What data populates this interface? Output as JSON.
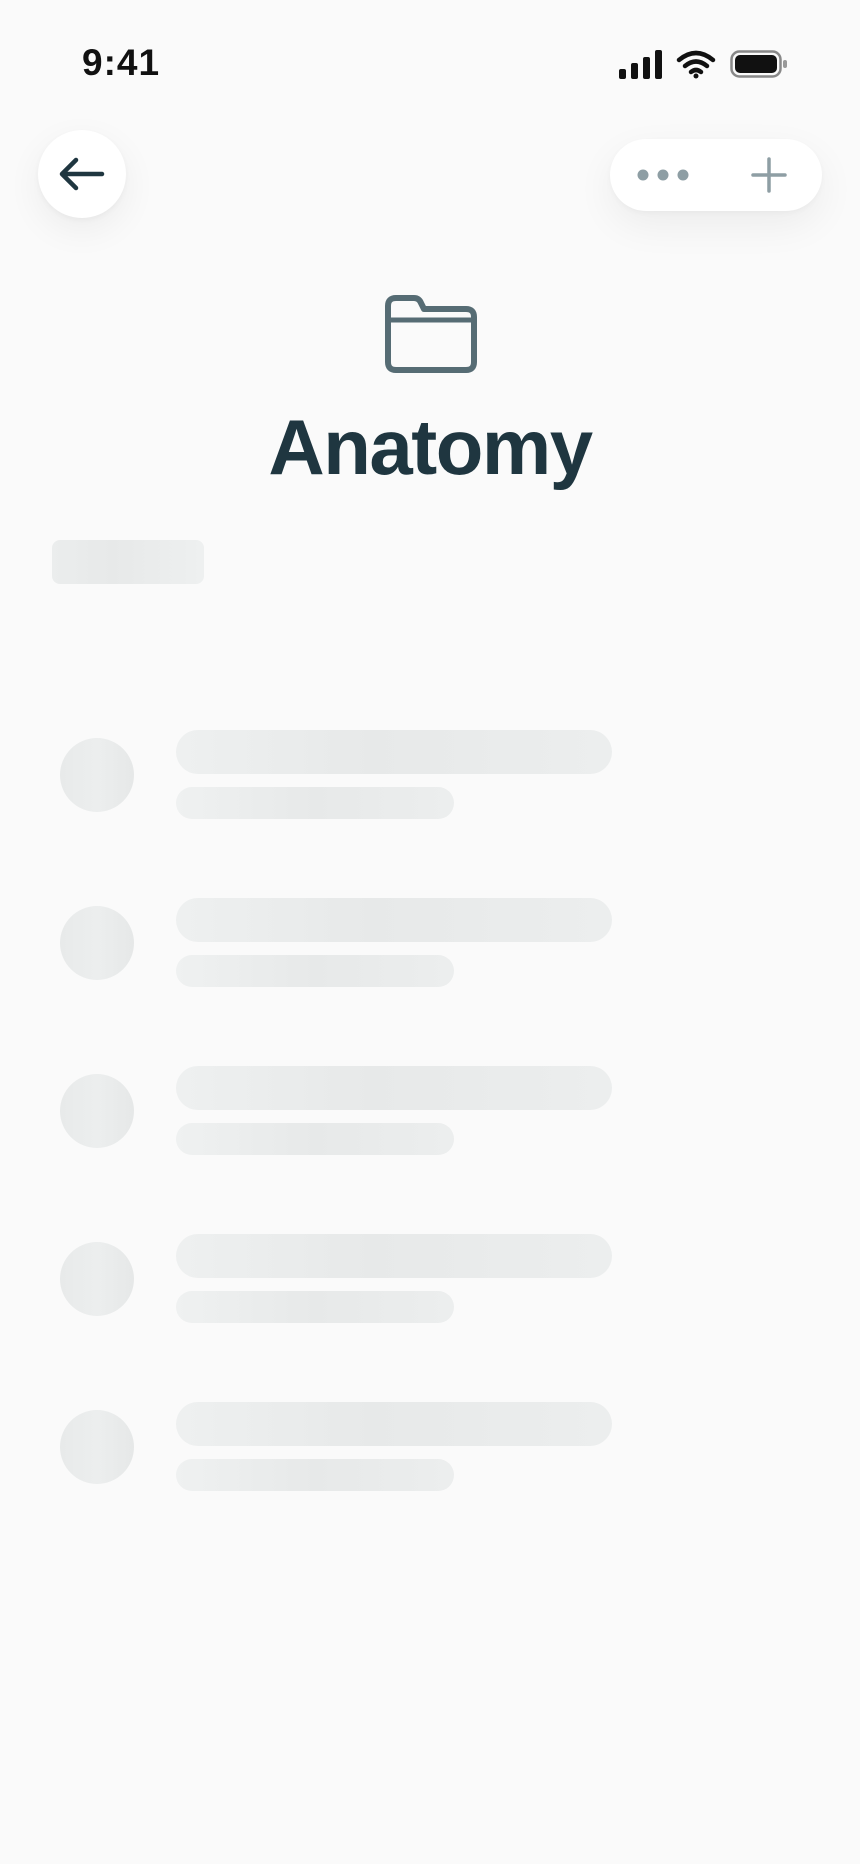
{
  "status_bar": {
    "time": "9:41"
  },
  "header": {
    "back_icon": "arrow-left-icon",
    "more_icon": "more-horizontal-icon",
    "add_icon": "plus-icon"
  },
  "folder": {
    "icon": "folder-icon",
    "title": "Anatomy"
  },
  "colors": {
    "title": "#1f3640",
    "folder_icon": "#566c74",
    "background": "#fafafa",
    "skeleton": "#e8eaea"
  }
}
